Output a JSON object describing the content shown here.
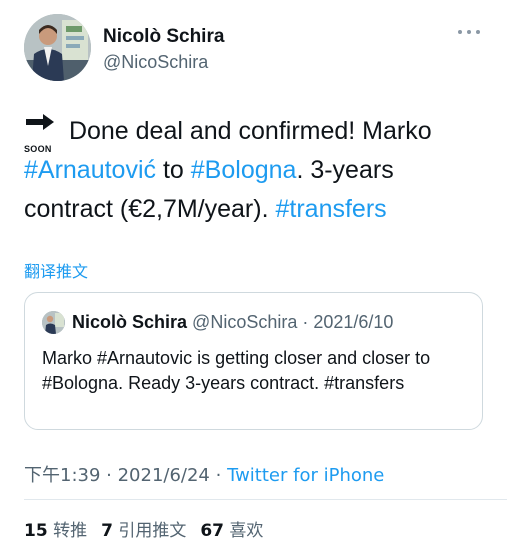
{
  "tweet": {
    "author_name": "Nicolò Schira",
    "author_handle": "@NicoSchira",
    "soon_label": "SOON",
    "text_parts": {
      "p1": " Done deal and confirmed! Marko ",
      "tag1": "#Arnautović",
      "p2": " to ",
      "tag2": "#Bologna",
      "p3": ". 3-years contract (€2,7M/year). ",
      "tag3": "#transfers"
    },
    "translate_label": "翻译推文",
    "time": "下午1:39",
    "sep1": " · ",
    "date": "2021/6/24",
    "sep2": " · ",
    "source": "Twitter for iPhone"
  },
  "quote": {
    "author_name": "Nicolò Schira",
    "author_handle": "@NicoSchira",
    "sep": " · ",
    "date": "2021/6/10",
    "text": "Marko #Arnautovic is getting closer and closer to #Bologna. Ready 3-years contract. #transfers"
  },
  "stats": {
    "retweets_count": "15",
    "retweets_label": "转推",
    "quotes_count": "7",
    "quotes_label": "引用推文",
    "likes_count": "67",
    "likes_label": "喜欢"
  },
  "icons": {
    "more": "more-horizontal-icon",
    "soon": "soon-arrow-icon"
  },
  "colors": {
    "link": "#1d9bf0",
    "text": "#0f1419",
    "muted": "#536471",
    "border": "#cfd9de"
  }
}
